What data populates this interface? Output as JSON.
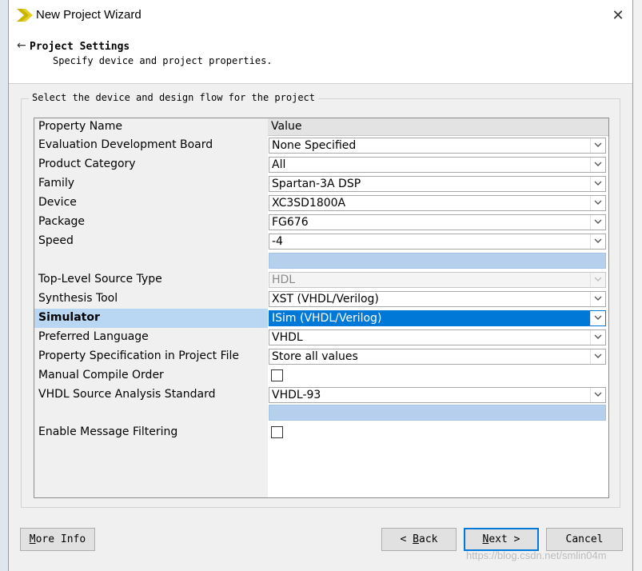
{
  "window": {
    "title": "New Project Wizard",
    "close_label": "✕"
  },
  "header": {
    "back_label": "←",
    "title": "Project Settings",
    "subtitle": "Specify device and project properties."
  },
  "group": {
    "legend": "Select the device and design flow for the project"
  },
  "table": {
    "col_property": "Property Name",
    "col_value": "Value",
    "rows": {
      "eval_board": {
        "label": "Evaluation Development Board",
        "value": "None Specified"
      },
      "product_category": {
        "label": "Product Category",
        "value": "All"
      },
      "family": {
        "label": "Family",
        "value": "Spartan-3A DSP"
      },
      "device": {
        "label": "Device",
        "value": "XC3SD1800A"
      },
      "package": {
        "label": "Package",
        "value": "FG676"
      },
      "speed": {
        "label": "Speed",
        "value": "-4"
      },
      "top_level_source": {
        "label": "Top-Level Source Type",
        "value": "HDL"
      },
      "synthesis_tool": {
        "label": "Synthesis Tool",
        "value": "XST (VHDL/Verilog)"
      },
      "simulator": {
        "label": "Simulator",
        "value": "ISim (VHDL/Verilog)"
      },
      "preferred_language": {
        "label": "Preferred Language",
        "value": "VHDL"
      },
      "property_spec": {
        "label": "Property Specification in Project File",
        "value": "Store all values"
      },
      "manual_compile_order": {
        "label": "Manual Compile Order",
        "checked": false
      },
      "vhdl_standard": {
        "label": "VHDL Source Analysis Standard",
        "value": "VHDL-93"
      },
      "message_filtering": {
        "label": "Enable Message Filtering",
        "checked": false
      }
    }
  },
  "buttons": {
    "more_info": {
      "first": "M",
      "rest": "ore Info"
    },
    "back": {
      "prefix": "< ",
      "first": "B",
      "rest": "ack"
    },
    "next": {
      "first": "N",
      "rest": "ext >"
    },
    "cancel": "Cancel"
  },
  "watermark": "https://blog.csdn.net/smlin04m",
  "colors": {
    "selection": "#0078d7",
    "highlight_row": "#b9d7f3",
    "blue_bar": "#b5cfed",
    "logo": "#c9b400"
  }
}
